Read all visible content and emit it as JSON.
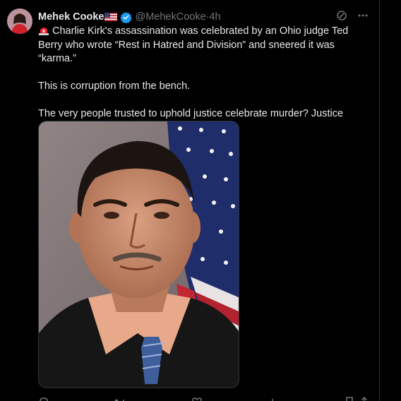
{
  "author": {
    "display_name": "Mehek Cooke",
    "handle": "@MehekCooke",
    "separator": " · ",
    "time": "4h",
    "flag_icon": "us-flag-icon",
    "verified_icon": "verified-badge-icon"
  },
  "tweet": {
    "line1": "Charlie Kirk's assassination was celebrated by an Ohio judge Ted Berry who wrote “Rest in Hatred and Division” and sneered it was “karma.”",
    "line2": "This is corruption from the bench.",
    "line3": "The very people trusted to uphold justice celebrate murder? Justice demands he has to go."
  },
  "colors": {
    "background": "#000000",
    "text": "#e7e9ea",
    "secondary": "#71767b",
    "verified": "#1d9bf0",
    "alarm": "#f4212e"
  }
}
